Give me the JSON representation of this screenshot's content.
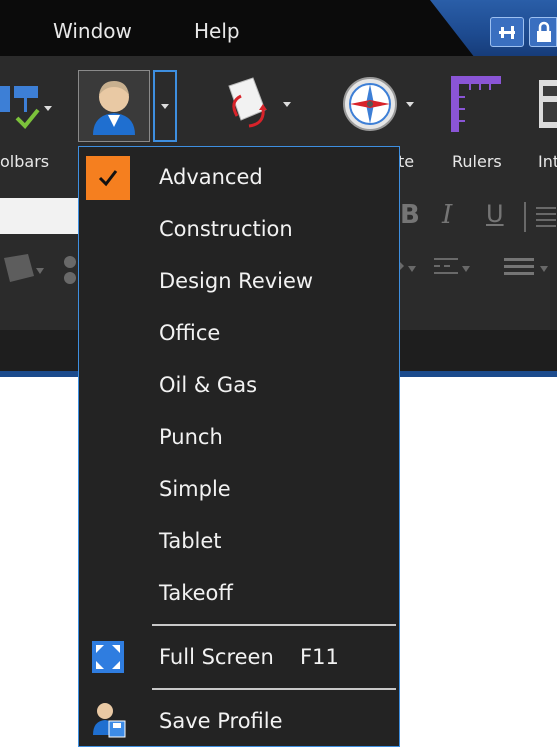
{
  "menubar": {
    "window": "Window",
    "help": "Help"
  },
  "toolbar": {
    "toolbars_label": "olbars",
    "navigate_label": "te",
    "rulers_label": "Rulers",
    "info_label": "Int"
  },
  "format": {
    "bold": "B",
    "italic": "I",
    "underline": "U"
  },
  "profiles_menu": {
    "items": [
      {
        "label": "Advanced",
        "checked": true
      },
      {
        "label": "Construction"
      },
      {
        "label": "Design Review"
      },
      {
        "label": "Office"
      },
      {
        "label": "Oil & Gas"
      },
      {
        "label": "Punch"
      },
      {
        "label": "Simple"
      },
      {
        "label": "Tablet"
      },
      {
        "label": "Takeoff"
      }
    ],
    "full_screen": {
      "label": "Full Screen",
      "shortcut": "F11"
    },
    "save_profile": {
      "label": "Save Profile"
    }
  },
  "colors": {
    "accent_blue": "#3e8fe0",
    "check_orange": "#f57f1f",
    "menu_bg": "#232323"
  }
}
